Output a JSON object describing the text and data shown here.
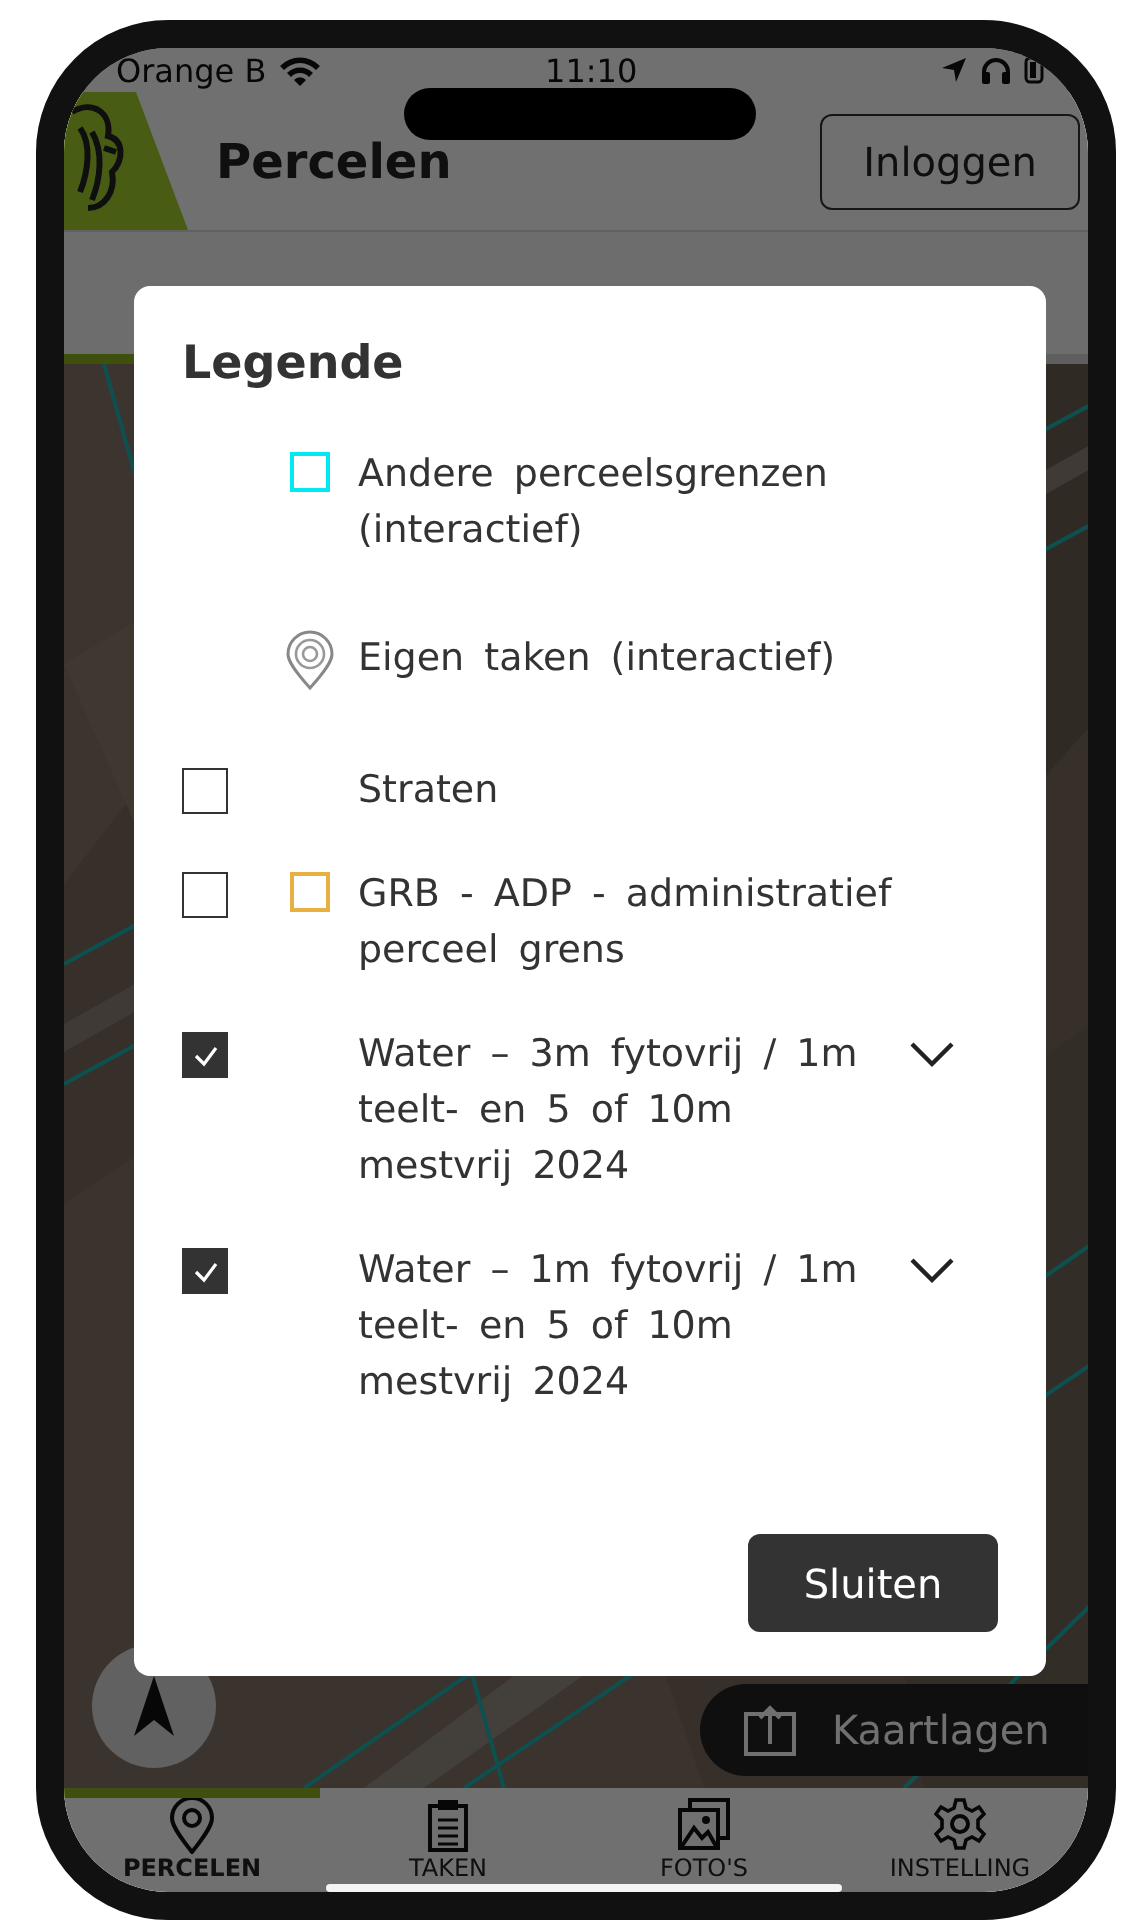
{
  "status_bar": {
    "carrier": "Orange B",
    "time": "11:10"
  },
  "header": {
    "title": "Percelen",
    "login_button": "Inloggen"
  },
  "tabs": [
    {
      "selected": true
    },
    {
      "selected": false
    }
  ],
  "map": {
    "layers_button": "Kaartlagen"
  },
  "bottom_nav": [
    {
      "kind": "pin",
      "label": "PERCELEN",
      "selected": true
    },
    {
      "kind": "clipboard",
      "label": "TAKEN",
      "selected": false
    },
    {
      "kind": "photos",
      "label": "FOTO'S",
      "selected": false
    },
    {
      "kind": "gear",
      "label": "INSTELLING",
      "selected": false
    }
  ],
  "legend": {
    "title": "Legende",
    "items": [
      {
        "kind": "swatch",
        "color": "#00e8f0",
        "label": "Andere perceelsgrenzen (interactief)"
      },
      {
        "kind": "marker",
        "label": "Eigen taken (interactief)"
      },
      {
        "kind": "layer",
        "checked": false,
        "label": "Straten"
      },
      {
        "kind": "layer",
        "checked": false,
        "color": "#e8b040",
        "label": "GRB - ADP - administratief perceel grens"
      },
      {
        "kind": "layer",
        "checked": true,
        "expandable": true,
        "label": "Water – 3m fytovrij / 1m teelt- en 5 of 10m mestvrij 2024"
      },
      {
        "kind": "layer",
        "checked": true,
        "expandable": true,
        "label": "Water – 1m fytovrij / 1m teelt- en 5 of 10m mestvrij 2024"
      }
    ],
    "close_button": "Sluiten"
  }
}
